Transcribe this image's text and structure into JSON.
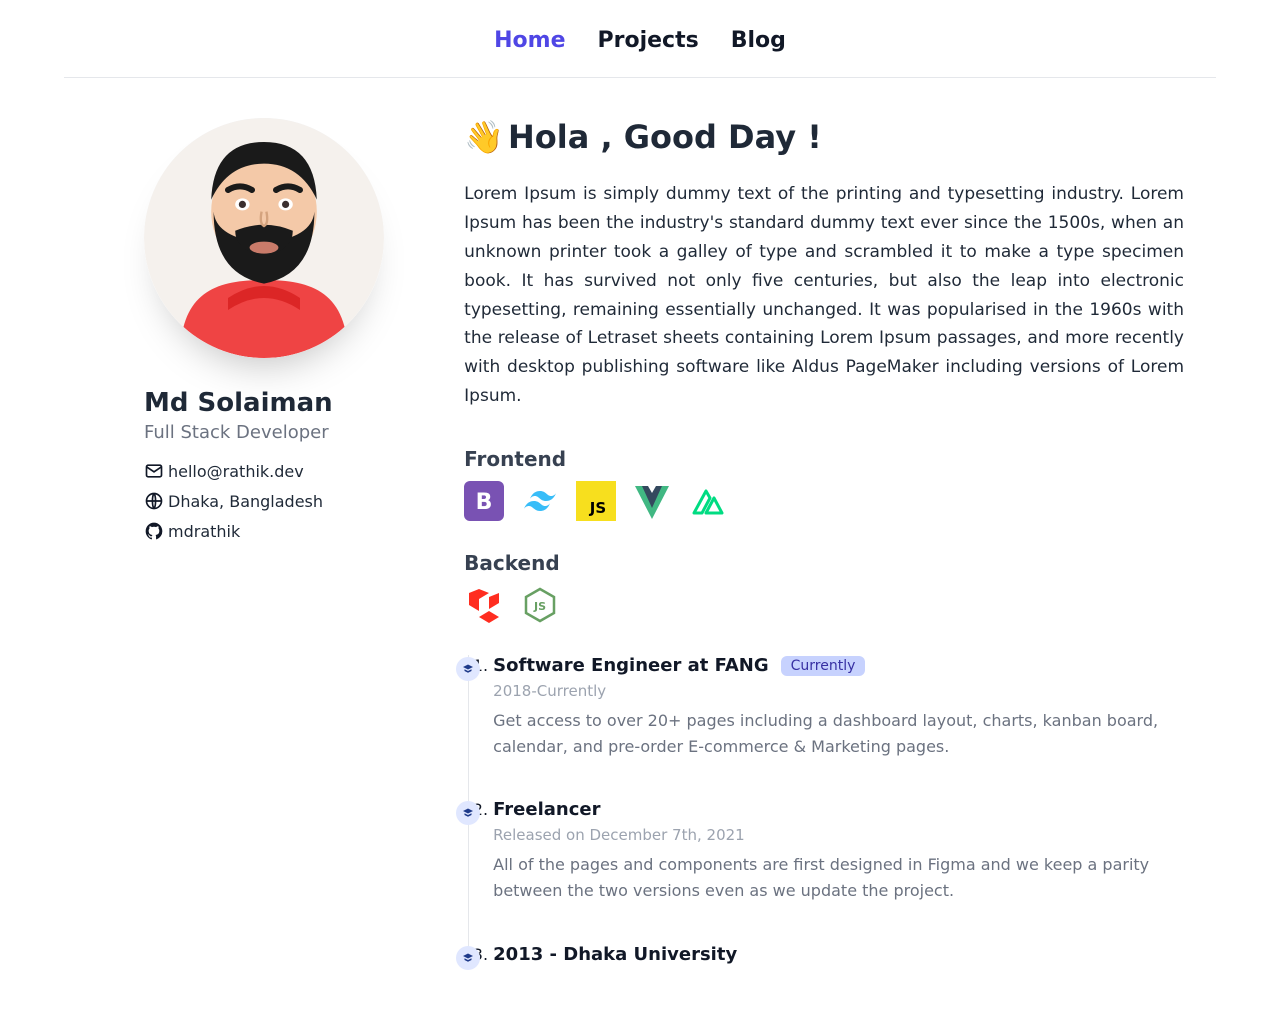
{
  "nav": {
    "home": "Home",
    "projects": "Projects",
    "blog": "Blog"
  },
  "profile": {
    "name": "Md Solaiman",
    "role": "Full Stack Developer",
    "email": "hello@rathik.dev",
    "location": "Dhaka, Bangladesh",
    "github": "mdrathik"
  },
  "headline": {
    "emoji": "👋",
    "text": "Hola , Good Day !"
  },
  "intro": "Lorem Ipsum is simply dummy text of the printing and typesetting industry. Lorem Ipsum has been the industry's standard dummy text ever since the 1500s, when an unknown printer took a galley of type and scrambled it to make a type specimen book. It has survived not only five centuries, but also the leap into electronic typesetting, remaining essentially unchanged. It was popularised in the 1960s with the release of Letraset sheets containing Lorem Ipsum passages, and more recently with desktop publishing software like Aldus PageMaker including versions of Lorem Ipsum.",
  "sections": {
    "frontend": "Frontend",
    "backend": "Backend"
  },
  "timeline": [
    {
      "title": "Software Engineer at FANG",
      "badge": "Currently",
      "date": "2018-Currently",
      "desc": "Get access to over 20+ pages including a dashboard layout, charts, kanban board, calendar, and pre-order E-commerce & Marketing pages."
    },
    {
      "title": "Freelancer",
      "badge": "",
      "date": "Released on December 7th, 2021",
      "desc": "All of the pages and components are first designed in Figma and we keep a parity between the two versions even as we update the project."
    },
    {
      "title": "2013 - Dhaka University",
      "badge": "",
      "date": "",
      "desc": ""
    }
  ]
}
